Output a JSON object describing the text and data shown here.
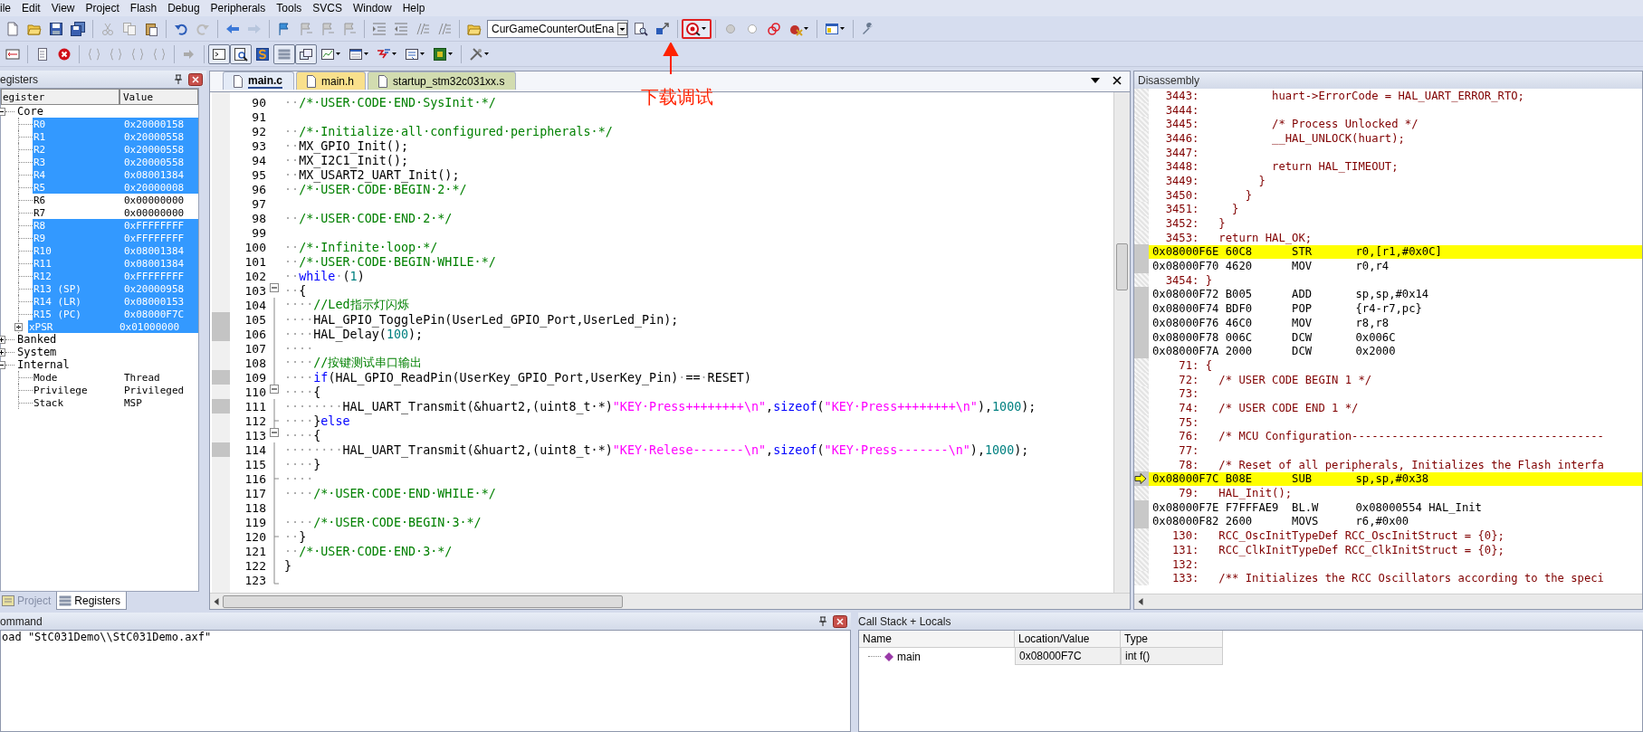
{
  "menu": [
    "ile",
    "Edit",
    "View",
    "Project",
    "Flash",
    "Debug",
    "Peripherals",
    "Tools",
    "SVCS",
    "Window",
    "Help"
  ],
  "toolbar_1": {
    "target_combo": {
      "value": "CurGameCounterOutEna"
    },
    "debug_button": {
      "active": true
    }
  },
  "toolbar_2": {
    "window_buttons": [
      {
        "pressed": true
      },
      {
        "pressed": true
      },
      {
        "pressed": false
      },
      {
        "pressed": true
      },
      {
        "pressed": true
      }
    ]
  },
  "annotation": {
    "text": "下载调试"
  },
  "registers": {
    "title": "egisters",
    "columns": [
      "egister",
      "Value"
    ],
    "groups": [
      {
        "name": "Core",
        "expanded": true,
        "children": [
          {
            "name": "R0",
            "value": "0x20000158",
            "selected": true
          },
          {
            "name": "R1",
            "value": "0x20000558",
            "selected": true
          },
          {
            "name": "R2",
            "value": "0x20000558",
            "selected": true
          },
          {
            "name": "R3",
            "value": "0x20000558",
            "selected": true
          },
          {
            "name": "R4",
            "value": "0x08001384",
            "selected": true
          },
          {
            "name": "R5",
            "value": "0x20000008",
            "selected": true
          },
          {
            "name": "R6",
            "value": "0x00000000",
            "selected": false
          },
          {
            "name": "R7",
            "value": "0x00000000",
            "selected": false
          },
          {
            "name": "R8",
            "value": "0xFFFFFFFF",
            "selected": true
          },
          {
            "name": "R9",
            "value": "0xFFFFFFFF",
            "selected": true
          },
          {
            "name": "R10",
            "value": "0x08001384",
            "selected": true
          },
          {
            "name": "R11",
            "value": "0x08001384",
            "selected": true
          },
          {
            "name": "R12",
            "value": "0xFFFFFFFF",
            "selected": true
          },
          {
            "name": "R13 (SP)",
            "value": "0x20000958",
            "selected": true
          },
          {
            "name": "R14 (LR)",
            "value": "0x08000153",
            "selected": true
          },
          {
            "name": "R15 (PC)",
            "value": "0x08000F7C",
            "selected": true
          },
          {
            "name": "xPSR",
            "value": "0x01000000",
            "selected": true,
            "expanded": false
          }
        ]
      },
      {
        "name": "Banked",
        "expanded": false
      },
      {
        "name": "System",
        "expanded": false
      },
      {
        "name": "Internal",
        "expanded": true,
        "children": [
          {
            "name": "Mode",
            "value": "Thread",
            "selected": false
          },
          {
            "name": "Privilege",
            "value": "Privileged",
            "selected": false
          },
          {
            "name": "Stack",
            "value": "MSP",
            "selected": false
          }
        ]
      }
    ],
    "tabs": [
      {
        "label": "Project",
        "selected": false
      },
      {
        "label": "Registers",
        "selected": true
      }
    ]
  },
  "editor": {
    "tabs": [
      {
        "label": "main.c",
        "selected": true,
        "color": "#e4ebf7"
      },
      {
        "label": "main.h",
        "selected": false,
        "color": "#f9e08c"
      },
      {
        "label": "startup_stm32c031xx.s",
        "selected": false,
        "color": "#d2dcb0"
      }
    ],
    "lines": [
      {
        "number": "90",
        "marked": false,
        "segments": [
          {
            "kind": "ws",
            "text": "··"
          },
          {
            "kind": "comment",
            "text": "/*·USER·CODE·END·SysInit·*/"
          }
        ]
      },
      {
        "number": "91",
        "marked": false
      },
      {
        "number": "92",
        "marked": false,
        "segments": [
          {
            "kind": "ws",
            "text": "··"
          },
          {
            "kind": "comment",
            "text": "/*·Initialize·all·configured·peripherals·*/"
          }
        ]
      },
      {
        "number": "93",
        "marked": false,
        "segments": [
          {
            "kind": "ws",
            "text": "··"
          },
          {
            "kind": "plain",
            "text": "MX_GPIO_Init();"
          }
        ]
      },
      {
        "number": "94",
        "marked": false,
        "segments": [
          {
            "kind": "ws",
            "text": "··"
          },
          {
            "kind": "plain",
            "text": "MX_I2C1_Init();"
          }
        ]
      },
      {
        "number": "95",
        "marked": false,
        "segments": [
          {
            "kind": "ws",
            "text": "··"
          },
          {
            "kind": "plain",
            "text": "MX_USART2_UART_Init();"
          }
        ]
      },
      {
        "number": "96",
        "marked": false,
        "segments": [
          {
            "kind": "ws",
            "text": "··"
          },
          {
            "kind": "comment",
            "text": "/*·USER·CODE·BEGIN·2·*/"
          }
        ]
      },
      {
        "number": "97",
        "marked": false
      },
      {
        "number": "98",
        "marked": false,
        "segments": [
          {
            "kind": "ws",
            "text": "··"
          },
          {
            "kind": "comment",
            "text": "/*·USER·CODE·END·2·*/"
          }
        ]
      },
      {
        "number": "99",
        "marked": false
      },
      {
        "number": "100",
        "marked": false,
        "segments": [
          {
            "kind": "ws",
            "text": "··"
          },
          {
            "kind": "comment",
            "text": "/*·Infinite·loop·*/"
          }
        ]
      },
      {
        "number": "101",
        "marked": false,
        "segments": [
          {
            "kind": "ws",
            "text": "··"
          },
          {
            "kind": "comment",
            "text": "/*·USER·CODE·BEGIN·WHILE·*/"
          }
        ]
      },
      {
        "number": "102",
        "marked": false,
        "segments": [
          {
            "kind": "ws",
            "text": "··"
          },
          {
            "kind": "keyword",
            "text": "while"
          },
          {
            "kind": "ws",
            "text": "·"
          },
          {
            "kind": "plain",
            "text": "("
          },
          {
            "kind": "number",
            "text": "1"
          },
          {
            "kind": "plain",
            "text": ")"
          }
        ]
      },
      {
        "number": "103",
        "marked": false,
        "kind": "open",
        "segments": [
          {
            "kind": "ws",
            "text": "··"
          },
          {
            "kind": "plain",
            "text": "{"
          }
        ]
      },
      {
        "number": "104",
        "marked": false,
        "kind": "line",
        "segments": [
          {
            "kind": "ws",
            "text": "····"
          },
          {
            "kind": "comment",
            "text": "//Led指示灯闪烁"
          }
        ]
      },
      {
        "number": "105",
        "marked": true,
        "kind": "line",
        "segments": [
          {
            "kind": "ws",
            "text": "····"
          },
          {
            "kind": "plain",
            "text": "HAL_GPIO_TogglePin(UserLed_GPIO_Port,UserLed_Pin);"
          }
        ]
      },
      {
        "number": "106",
        "marked": true,
        "kind": "line",
        "segments": [
          {
            "kind": "ws",
            "text": "····"
          },
          {
            "kind": "plain",
            "text": "HAL_Delay("
          },
          {
            "kind": "number",
            "text": "100"
          },
          {
            "kind": "plain",
            "text": ");"
          }
        ]
      },
      {
        "number": "107",
        "marked": false,
        "kind": "line",
        "segments": [
          {
            "kind": "ws",
            "text": "····"
          }
        ]
      },
      {
        "number": "108",
        "marked": false,
        "kind": "line",
        "segments": [
          {
            "kind": "ws",
            "text": "····"
          },
          {
            "kind": "comment",
            "text": "//按键测试串口输出"
          }
        ]
      },
      {
        "number": "109",
        "marked": true,
        "kind": "line",
        "segments": [
          {
            "kind": "ws",
            "text": "····"
          },
          {
            "kind": "keyword",
            "text": "if"
          },
          {
            "kind": "plain",
            "text": "(HAL_GPIO_ReadPin(UserKey_GPIO_Port,UserKey_Pin)"
          },
          {
            "kind": "ws",
            "text": "·"
          },
          {
            "kind": "plain",
            "text": "=="
          },
          {
            "kind": "ws",
            "text": "·"
          },
          {
            "kind": "plain",
            "text": "RESET)"
          }
        ]
      },
      {
        "number": "110",
        "marked": false,
        "kind": "open",
        "segments": [
          {
            "kind": "ws",
            "text": "····"
          },
          {
            "kind": "plain",
            "text": "{"
          }
        ]
      },
      {
        "number": "111",
        "marked": true,
        "kind": "line",
        "segments": [
          {
            "kind": "ws",
            "text": "········"
          },
          {
            "kind": "plain",
            "text": "HAL_UART_Transmit(&huart2,(uint8_t·*)"
          },
          {
            "kind": "string",
            "text": "\"KEY·Press++++++++\\n\""
          },
          {
            "kind": "plain",
            "text": ","
          },
          {
            "kind": "keyword",
            "text": "sizeof"
          },
          {
            "kind": "plain",
            "text": "("
          },
          {
            "kind": "string",
            "text": "\"KEY·Press++++++++\\n\""
          },
          {
            "kind": "plain",
            "text": "),"
          },
          {
            "kind": "number",
            "text": "1000"
          },
          {
            "kind": "plain",
            "text": ");"
          }
        ]
      },
      {
        "number": "112",
        "marked": false,
        "kind": "branch",
        "segments": [
          {
            "kind": "ws",
            "text": "····"
          },
          {
            "kind": "plain",
            "text": "}"
          },
          {
            "kind": "keyword",
            "text": "else"
          }
        ]
      },
      {
        "number": "113",
        "marked": false,
        "kind": "open",
        "segments": [
          {
            "kind": "ws",
            "text": "····"
          },
          {
            "kind": "plain",
            "text": "{"
          }
        ]
      },
      {
        "number": "114",
        "marked": true,
        "kind": "line",
        "segments": [
          {
            "kind": "ws",
            "text": "········"
          },
          {
            "kind": "plain",
            "text": "HAL_UART_Transmit(&huart2,(uint8_t·*)"
          },
          {
            "kind": "string",
            "text": "\"KEY·Relese-------\\n\""
          },
          {
            "kind": "plain",
            "text": ","
          },
          {
            "kind": "keyword",
            "text": "sizeof"
          },
          {
            "kind": "plain",
            "text": "("
          },
          {
            "kind": "string",
            "text": "\"KEY·Press-------\\n\""
          },
          {
            "kind": "plain",
            "text": "),"
          },
          {
            "kind": "number",
            "text": "1000"
          },
          {
            "kind": "plain",
            "text": ");"
          }
        ]
      },
      {
        "number": "115",
        "marked": false,
        "kind": "line",
        "segments": [
          {
            "kind": "ws",
            "text": "····"
          },
          {
            "kind": "plain",
            "text": "}"
          }
        ]
      },
      {
        "number": "116",
        "marked": false,
        "kind": "branch",
        "segments": [
          {
            "kind": "ws",
            "text": "····"
          }
        ]
      },
      {
        "number": "117",
        "marked": false,
        "kind": "line",
        "segments": [
          {
            "kind": "ws",
            "text": "····"
          },
          {
            "kind": "comment",
            "text": "/*·USER·CODE·END·WHILE·*/"
          }
        ]
      },
      {
        "number": "118",
        "marked": false,
        "kind": "line"
      },
      {
        "number": "119",
        "marked": false,
        "kind": "line",
        "segments": [
          {
            "kind": "ws",
            "text": "····"
          },
          {
            "kind": "comment",
            "text": "/*·USER·CODE·BEGIN·3·*/"
          }
        ]
      },
      {
        "number": "120",
        "marked": false,
        "kind": "branch",
        "segments": [
          {
            "kind": "ws",
            "text": "··"
          },
          {
            "kind": "plain",
            "text": "}"
          }
        ]
      },
      {
        "number": "121",
        "marked": false,
        "kind": "line",
        "segments": [
          {
            "kind": "ws",
            "text": "··"
          },
          {
            "kind": "comment",
            "text": "/*·USER·CODE·END·3·*/"
          }
        ]
      },
      {
        "number": "122",
        "marked": false,
        "kind": "line",
        "segments": [
          {
            "kind": "plain",
            "text": "}"
          }
        ]
      },
      {
        "number": "123",
        "marked": false,
        "kind": "end"
      }
    ]
  },
  "disassembly": {
    "title": "Disassembly",
    "lines": [
      {
        "kind": "source",
        "number": "3443:",
        "code": "           huart->ErrorCode = HAL_UART_ERROR_RTO;"
      },
      {
        "kind": "source",
        "number": "3444:"
      },
      {
        "kind": "source",
        "number": "3445:",
        "code": "           /* Process Unlocked */"
      },
      {
        "kind": "source",
        "number": "3446:",
        "code": "           __HAL_UNLOCK(huart);"
      },
      {
        "kind": "source",
        "number": "3447:"
      },
      {
        "kind": "source",
        "number": "3448:",
        "code": "           return HAL_TIMEOUT;"
      },
      {
        "kind": "source",
        "number": "3449:",
        "code": "         }"
      },
      {
        "kind": "source",
        "number": "3450:",
        "code": "       }"
      },
      {
        "kind": "source",
        "number": "3451:",
        "code": "     }"
      },
      {
        "kind": "source",
        "number": "3452:",
        "code": "   }"
      },
      {
        "kind": "source",
        "number": "3453:",
        "code": "   return HAL_OK;"
      },
      {
        "kind": "asm",
        "address": "0x08000F6E",
        "opcode": "60C8",
        "mnemonic": "STR",
        "operand": "r0,[r1,#0x0C]",
        "highlighted": true,
        "current": false
      },
      {
        "kind": "asm",
        "address": "0x08000F70",
        "opcode": "4620",
        "mnemonic": "MOV",
        "operand": "r0,r4",
        "highlighted": false,
        "current": false
      },
      {
        "kind": "source",
        "number": "3454:",
        "code": " }"
      },
      {
        "kind": "asm",
        "address": "0x08000F72",
        "opcode": "B005",
        "mnemonic": "ADD",
        "operand": "sp,sp,#0x14",
        "highlighted": false,
        "current": false
      },
      {
        "kind": "asm",
        "address": "0x08000F74",
        "opcode": "BDF0",
        "mnemonic": "POP",
        "operand": "{r4-r7,pc}",
        "highlighted": false,
        "current": false
      },
      {
        "kind": "asm",
        "address": "0x08000F76",
        "opcode": "46C0",
        "mnemonic": "MOV",
        "operand": "r8,r8",
        "highlighted": false,
        "current": false
      },
      {
        "kind": "asm",
        "address": "0x08000F78",
        "opcode": "006C",
        "mnemonic": "DCW",
        "operand": "0x006C",
        "highlighted": false,
        "current": false
      },
      {
        "kind": "asm",
        "address": "0x08000F7A",
        "opcode": "2000",
        "mnemonic": "DCW",
        "operand": "0x2000",
        "highlighted": false,
        "current": false
      },
      {
        "kind": "source",
        "number": "71:",
        "code": " {"
      },
      {
        "kind": "source",
        "number": "72:",
        "code": "   /* USER CODE BEGIN 1 */"
      },
      {
        "kind": "source",
        "number": "73:"
      },
      {
        "kind": "source",
        "number": "74:",
        "code": "   /* USER CODE END 1 */"
      },
      {
        "kind": "source",
        "number": "75:"
      },
      {
        "kind": "source",
        "number": "76:",
        "code": "   /* MCU Configuration--------------------------------------"
      },
      {
        "kind": "source",
        "number": "77:"
      },
      {
        "kind": "source",
        "number": "78:",
        "code": "   /* Reset of all peripherals, Initializes the Flash interfa"
      },
      {
        "kind": "asm",
        "address": "0x08000F7C",
        "opcode": "B08E",
        "mnemonic": "SUB",
        "operand": "sp,sp,#0x38",
        "highlighted": true,
        "current": true
      },
      {
        "kind": "source",
        "number": "79:",
        "code": "   HAL_Init();"
      },
      {
        "kind": "asm",
        "address": "0x08000F7E",
        "opcode": "F7FFFAE9",
        "mnemonic": "BL.W",
        "operand": "0x08000554 HAL_Init",
        "highlighted": false,
        "current": false
      },
      {
        "kind": "asm",
        "address": "0x08000F82",
        "opcode": "2600",
        "mnemonic": "MOVS",
        "operand": "r6,#0x00",
        "highlighted": false,
        "current": false
      },
      {
        "kind": "source",
        "number": "130:",
        "code": "   RCC_OscInitTypeDef RCC_OscInitStruct = {0};"
      },
      {
        "kind": "source",
        "number": "131:",
        "code": "   RCC_ClkInitTypeDef RCC_ClkInitStruct = {0};"
      },
      {
        "kind": "source",
        "number": "132:"
      },
      {
        "kind": "source",
        "number": "133:",
        "code": "   /** Initializes the RCC Oscillators according to the speci"
      }
    ]
  },
  "command": {
    "title": "ommand",
    "output": "oad \"StC031Demo\\\\StC031Demo.axf\""
  },
  "call_stack": {
    "title": "Call Stack + Locals",
    "columns": [
      "Name",
      "Location/Value",
      "Type"
    ],
    "rows": [
      {
        "name": "main",
        "location": "0x08000F7C",
        "type": "int f()"
      }
    ]
  }
}
